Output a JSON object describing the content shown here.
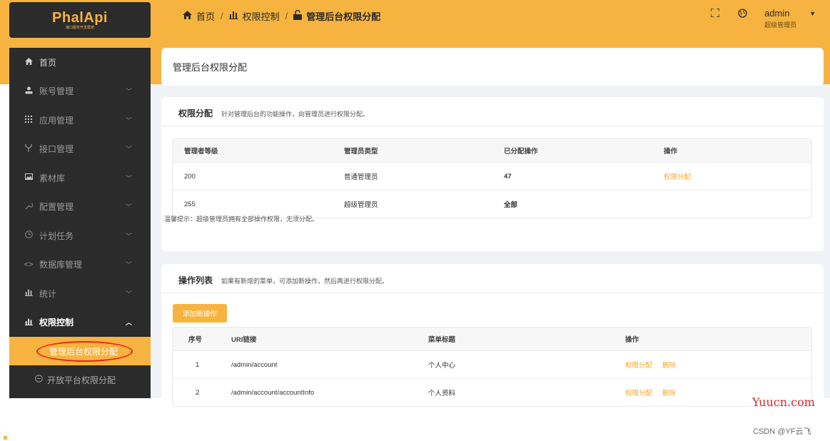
{
  "logo": {
    "name": "PhalApi",
    "subtitle": "接口服务开发框架"
  },
  "breadcrumb": {
    "home": "首页",
    "section": "权限控制",
    "current": "管理后台权限分配"
  },
  "user": {
    "name": "admin",
    "role": "超级管理员"
  },
  "sidebar": {
    "items": [
      {
        "label": "首页",
        "icon": "home-icon"
      },
      {
        "label": "账号管理",
        "icon": "user-icon"
      },
      {
        "label": "应用管理",
        "icon": "grid-icon"
      },
      {
        "label": "接口管理",
        "icon": "api-icon"
      },
      {
        "label": "素材库",
        "icon": "image-icon"
      },
      {
        "label": "配置管理",
        "icon": "wrench-icon"
      },
      {
        "label": "计划任务",
        "icon": "clock-icon"
      },
      {
        "label": "数据库管理",
        "icon": "code-icon"
      },
      {
        "label": "统计",
        "icon": "bar-chart-icon"
      },
      {
        "label": "权限控制",
        "icon": "bar-chart-icon"
      }
    ],
    "sub_items": [
      {
        "label": "管理后台权限分配"
      },
      {
        "label": "开放平台权限分配"
      }
    ]
  },
  "page_title": "管理后台权限分配",
  "assign": {
    "title": "权限分配",
    "desc": "针对管理后台的功能操作，向管理员进行权限分配。",
    "columns": [
      "管理者等级",
      "管理员类型",
      "已分配操作",
      "操作"
    ],
    "rows": [
      {
        "level": "200",
        "type": "普通管理员",
        "assigned": "47",
        "action": "权限分配"
      },
      {
        "level": "255",
        "type": "超级管理员",
        "assigned": "全部",
        "action": ""
      }
    ],
    "tip": "温馨提示：超级管理员拥有全部操作权限，无须分配。"
  },
  "ops": {
    "title": "操作列表",
    "desc": "如果有新增的菜单，可添加新操作，然后再进行权限分配。",
    "add_label": "添加新操作",
    "columns": [
      "序号",
      "URI链接",
      "菜单标题",
      "操作"
    ],
    "rows": [
      {
        "no": "1",
        "uri": "/admin/account",
        "title": "个人中心",
        "a1": "权限分配",
        "a2": "删除"
      },
      {
        "no": "2",
        "uri": "/admin/account/accountInfo",
        "title": "个人资料",
        "a1": "权限分配",
        "a2": "删除"
      }
    ]
  },
  "watermark": {
    "site": "Yuucn.com",
    "author": "CSDN @YF云飞"
  },
  "colors": {
    "accent": "#f6b340",
    "sidebar_bg": "#2b2b2b",
    "link": "#f6a623",
    "annotation": "#e8261b"
  }
}
